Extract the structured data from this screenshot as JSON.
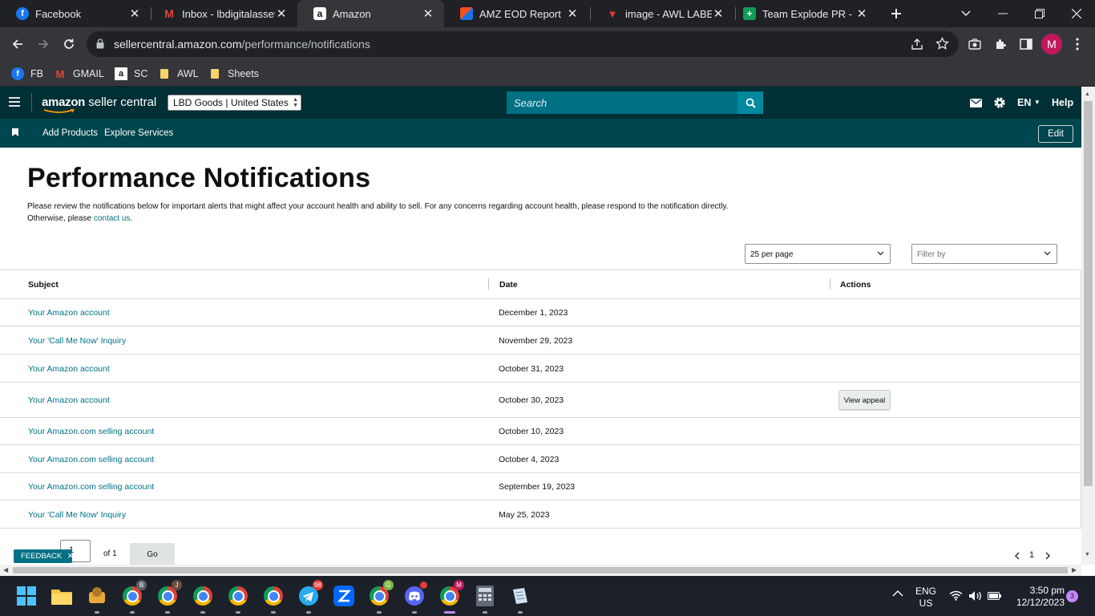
{
  "browser": {
    "tabs": [
      {
        "title": "Facebook",
        "icon": "facebook-icon",
        "active": false
      },
      {
        "title": "Inbox - lbdigitalassets",
        "icon": "gmail-icon",
        "active": false
      },
      {
        "title": "Amazon",
        "icon": "amazon-icon",
        "active": true
      },
      {
        "title": "AMZ EOD Report",
        "icon": "report-icon",
        "active": false
      },
      {
        "title": "image - AWL LABEL",
        "icon": "image-icon",
        "active": false
      },
      {
        "title": "Team Explode PR - Go",
        "icon": "sheets-icon",
        "active": false
      }
    ],
    "url_host": "sellercentral.amazon.com",
    "url_path": "/performance/notifications",
    "profile_initial": "M",
    "bookmarks": [
      {
        "label": "FB",
        "icon": "facebook-icon"
      },
      {
        "label": "GMAIL",
        "icon": "gmail-icon"
      },
      {
        "label": "SC",
        "icon": "amazon-icon"
      },
      {
        "label": "AWL",
        "icon": "folder-icon"
      },
      {
        "label": "Sheets",
        "icon": "folder-icon"
      }
    ]
  },
  "seller_central": {
    "logo_text_bold": "amazon",
    "logo_text": " seller central",
    "store_selector": "LBD Goods | United States",
    "search_placeholder": "Search",
    "language": "EN",
    "help_label": "Help",
    "nav_links": [
      "Add Products",
      "Explore Services"
    ],
    "edit_label": "Edit"
  },
  "page": {
    "title": "Performance Notifications",
    "intro_text": "Please review the notifications below for important alerts that might affect your account health and ability to sell. For any concerns regarding account health, please respond to the notification directly. Otherwise, please ",
    "contact_link": "contact us",
    "intro_end": ".",
    "per_page": "25 per page",
    "filter_placeholder": "Filter by",
    "columns": [
      "Subject",
      "Date",
      "Actions"
    ],
    "rows": [
      {
        "subject": "Your Amazon account",
        "date": "December 1, 2023",
        "action": ""
      },
      {
        "subject": "Your 'Call Me Now' Inquiry",
        "date": "November 29, 2023",
        "action": ""
      },
      {
        "subject": "Your Amazon account",
        "date": "October 31, 2023",
        "action": ""
      },
      {
        "subject": "Your Amazon account",
        "date": "October 30, 2023",
        "action": "View appeal"
      },
      {
        "subject": "Your Amazon.com selling account",
        "date": "October 10, 2023",
        "action": ""
      },
      {
        "subject": "Your Amazon.com selling account",
        "date": "October 4, 2023",
        "action": ""
      },
      {
        "subject": "Your Amazon.com selling account",
        "date": "September 19, 2023",
        "action": ""
      },
      {
        "subject": "Your 'Call Me Now' Inquiry",
        "date": "May 25, 2023",
        "action": ""
      }
    ],
    "pager": {
      "current": "1",
      "of_label": "of 1",
      "go_label": "Go",
      "page_number": "1"
    },
    "feedback_label": "FEEDBACK"
  },
  "taskbar": {
    "language_top": "ENG",
    "language_bottom": "US",
    "time": "3:50 pm",
    "date": "12/12/2023",
    "notification_count": "3",
    "telegram_badge": "98"
  },
  "colors": {
    "header_bg": "#002f36",
    "subheader_bg": "#00464f",
    "link": "#007185",
    "search_bg": "#007185"
  }
}
